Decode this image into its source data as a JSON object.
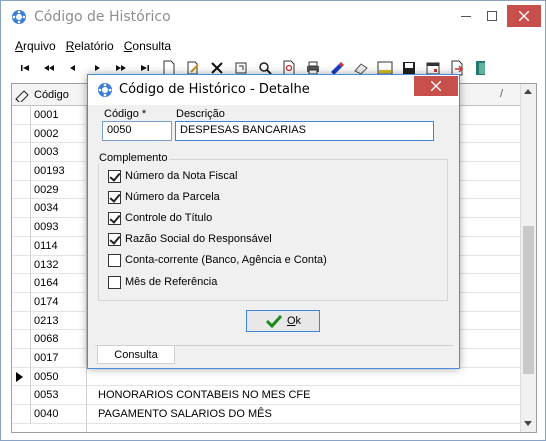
{
  "main": {
    "title": "Código de Histórico",
    "menu": [
      {
        "label_u": "A",
        "label_rest": "rquivo"
      },
      {
        "label_u": "R",
        "label_rest": "elatório"
      },
      {
        "label_u": "C",
        "label_rest": "onsulta"
      }
    ],
    "toolbar_icons": [
      "first-icon",
      "prev-page-icon",
      "prev-icon",
      "next-icon",
      "next-page-icon",
      "last-icon",
      "new-icon",
      "edit-icon",
      "delete-icon",
      "refresh-icon",
      "search-icon",
      "find-icon",
      "print-icon",
      "tool-icon",
      "eraser-icon",
      "filter-icon",
      "save-icon",
      "calendar-icon",
      "export-icon",
      "exit-icon"
    ]
  },
  "grid": {
    "header": {
      "code": "Código",
      "slash": "/"
    },
    "rows": [
      {
        "code": "0001",
        "desc": ""
      },
      {
        "code": "0002",
        "desc": ""
      },
      {
        "code": "0003",
        "desc": ""
      },
      {
        "code": "00193",
        "desc": ""
      },
      {
        "code": "0029",
        "desc": ""
      },
      {
        "code": "0034",
        "desc": ""
      },
      {
        "code": "0093",
        "desc": ""
      },
      {
        "code": "0114",
        "desc": ""
      },
      {
        "code": "0132",
        "desc": ""
      },
      {
        "code": "0164",
        "desc": ""
      },
      {
        "code": "0174",
        "desc": ""
      },
      {
        "code": "0213",
        "desc": ""
      },
      {
        "code": "0068",
        "desc": ""
      },
      {
        "code": "0017",
        "desc": ""
      },
      {
        "code": "0050",
        "desc": "",
        "current": true
      },
      {
        "code": "0053",
        "desc": "HONORARIOS CONTABEIS NO MES CFE"
      },
      {
        "code": "0040",
        "desc": "PAGAMENTO SALARIOS DO MÊS"
      }
    ]
  },
  "dialog": {
    "title": "Código de Histórico - Detalhe",
    "codigo_label": "Código *",
    "codigo_value": "0050",
    "descricao_label": "Descrição",
    "descricao_value": "DESPESAS BANCARIAS",
    "group_label": "Complemento",
    "options": [
      {
        "label": "Número da Nota Fiscal",
        "checked": true
      },
      {
        "label": "Número da Parcela",
        "checked": true
      },
      {
        "label": "Controle do Título",
        "checked": true
      },
      {
        "label": "Razão Social do Responsável",
        "checked": true
      },
      {
        "label": "Conta-corrente (Banco, Agência e Conta)",
        "checked": false
      },
      {
        "label": "Mês de Referência",
        "checked": false
      }
    ],
    "ok_u": "O",
    "ok_rest": "k",
    "tab": "Consulta"
  }
}
